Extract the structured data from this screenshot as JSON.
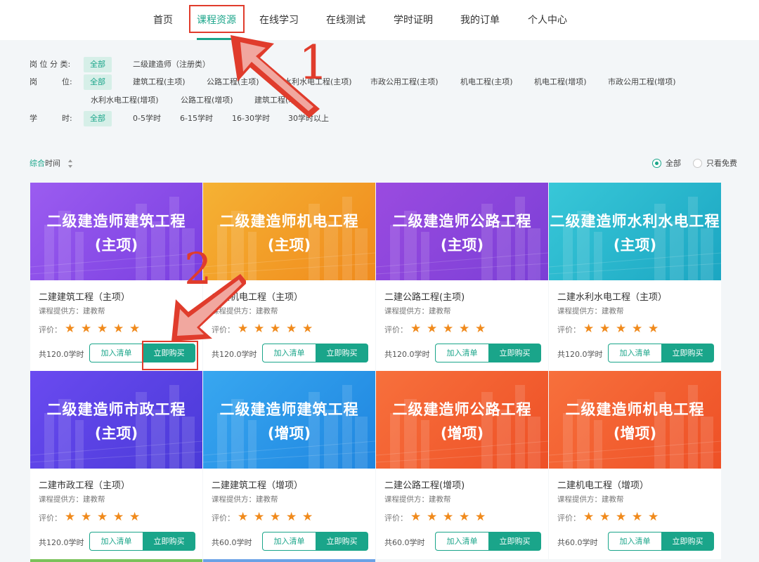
{
  "nav": {
    "items": [
      {
        "label": "首页"
      },
      {
        "label": "课程资源"
      },
      {
        "label": "在线学习"
      },
      {
        "label": "在线测试"
      },
      {
        "label": "学时证明"
      },
      {
        "label": "我的订单"
      },
      {
        "label": "个人中心"
      }
    ],
    "active_index": 1
  },
  "filters": {
    "category": {
      "label": "岗 位 分 类:",
      "options": [
        "全部",
        "二级建造师（注册类）"
      ],
      "selected": 0
    },
    "position": {
      "label": "岗          位:",
      "options": [
        "全部",
        "建筑工程(主项)",
        "公路工程(主项)",
        "水利水电工程(主项)",
        "市政公用工程(主项)",
        "机电工程(主项)",
        "机电工程(增项)",
        "市政公用工程(增项)",
        "水利水电工程(增项)",
        "公路工程(增项)",
        "建筑工程(增项)"
      ],
      "selected": 0
    },
    "hours": {
      "label": "学          时:",
      "options": [
        "全部",
        "0-5学时",
        "6-15学时",
        "16-30学时",
        "30学时以上"
      ],
      "selected": 0
    }
  },
  "sort": {
    "primary": "综合",
    "secondary": "时间"
  },
  "price_filter": {
    "options": [
      "全部",
      "只看免费"
    ],
    "selected": 0
  },
  "card_labels": {
    "provider_prefix": "课程提供方：",
    "rating": "评价：",
    "add_to_list": "加入清单",
    "buy_now": "立即购买"
  },
  "courses": [
    {
      "banner_title": "二级建造师建筑工程",
      "banner_sub": "(主项)",
      "name": "二建建筑工程（主项）",
      "provider": "建教帮",
      "rating": 5,
      "hours": "共120.0学时",
      "theme": "purple"
    },
    {
      "banner_title": "二级建造师机电工程",
      "banner_sub": "(主项)",
      "name": "二建机电工程（主项）",
      "provider": "建教帮",
      "rating": 5,
      "hours": "共120.0学时",
      "theme": "orange"
    },
    {
      "banner_title": "二级建造师公路工程",
      "banner_sub": "(主项)",
      "name": "二建公路工程(主项)",
      "provider": "建教帮",
      "rating": 5,
      "hours": "共120.0学时",
      "theme": "violet"
    },
    {
      "banner_title": "二级建造师水利水电工程",
      "banner_sub": "(主项)",
      "name": "二建水利水电工程（主项）",
      "provider": "建教帮",
      "rating": 5,
      "hours": "共120.0学时",
      "theme": "teal"
    },
    {
      "banner_title": "二级建造师市政工程",
      "banner_sub": "(主项)",
      "name": "二建市政工程（主项）",
      "provider": "建教帮",
      "rating": 5,
      "hours": "共120.0学时",
      "theme": "indigo"
    },
    {
      "banner_title": "二级建造师建筑工程",
      "banner_sub": "(增项)",
      "name": "二建建筑工程（增项）",
      "provider": "建教帮",
      "rating": 5,
      "hours": "共60.0学时",
      "theme": "blue"
    },
    {
      "banner_title": "二级建造师公路工程",
      "banner_sub": "(增项)",
      "name": "二建公路工程(增项)",
      "provider": "建教帮",
      "rating": 5,
      "hours": "共60.0学时",
      "theme": "red"
    },
    {
      "banner_title": "二级建造师机电工程",
      "banner_sub": "(增项)",
      "name": "二建机电工程（增项）",
      "provider": "建教帮",
      "rating": 5,
      "hours": "共60.0学时",
      "theme": "red"
    }
  ],
  "annotations": {
    "step1": "1",
    "step2": "2"
  },
  "colors": {
    "accent": "#1aa58a",
    "star": "#f08a1c",
    "annotation": "#e03c2c"
  }
}
